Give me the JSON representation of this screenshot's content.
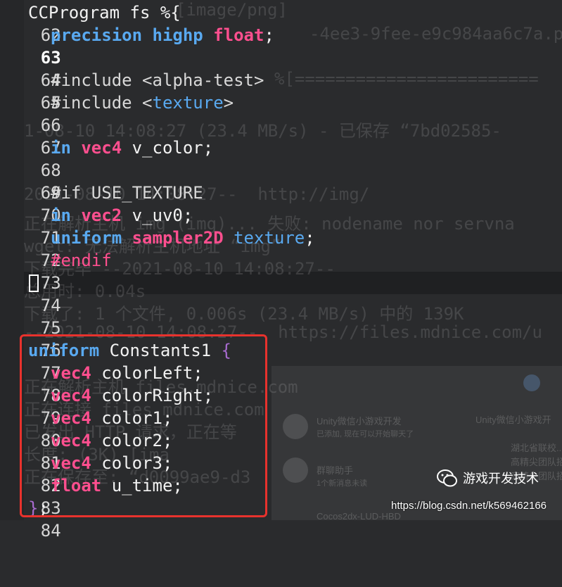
{
  "editor": {
    "active_line": "63",
    "lines": [
      {
        "n": "62",
        "tokens": [
          "CCProgram fs %{"
        ]
      },
      {
        "n": "63",
        "tokens": [
          "precision",
          "highp",
          "float",
          ";"
        ]
      },
      {
        "n": "64",
        "tokens": []
      },
      {
        "n": "65",
        "tokens": [
          "#include <alpha-test>"
        ]
      },
      {
        "n": "66",
        "tokens": [
          "#include <",
          "texture",
          ">"
        ]
      },
      {
        "n": "67",
        "tokens": []
      },
      {
        "n": "68",
        "tokens": [
          "in",
          "vec4",
          " v_color;"
        ]
      },
      {
        "n": "69",
        "tokens": []
      },
      {
        "n": "70",
        "tokens": [
          "#if USE_TEXTURE"
        ]
      },
      {
        "n": "71",
        "tokens": [
          "in",
          "vec2",
          " v_uv0;"
        ]
      },
      {
        "n": "72",
        "tokens": [
          "uniform",
          "sampler2D",
          "texture",
          ";"
        ]
      },
      {
        "n": "73",
        "tokens": [
          "#endif"
        ]
      },
      {
        "n": "74",
        "tokens": []
      },
      {
        "n": "75",
        "tokens": []
      },
      {
        "n": "76",
        "tokens": []
      },
      {
        "n": "77",
        "tokens": [
          "uniform",
          " Constants1 ",
          "{"
        ]
      },
      {
        "n": "78",
        "tokens": [
          "vec4",
          " colorLeft;"
        ]
      },
      {
        "n": "79",
        "tokens": [
          "vec4",
          " colorRight;"
        ]
      },
      {
        "n": "80",
        "tokens": [
          "vec4",
          " color1;"
        ]
      },
      {
        "n": "81",
        "tokens": [
          "vec4",
          " color2;"
        ]
      },
      {
        "n": "82",
        "tokens": [
          "vec4",
          " color3;"
        ]
      },
      {
        "n": "83",
        "tokens": [
          "float",
          " u_time;"
        ]
      },
      {
        "n": "84",
        "tokens": [
          "}",
          ";"
        ]
      }
    ]
  },
  "background_ghost": [
    "[image/png]",
    "-4ee3-9fee-e9c984aa6c7a.p",
    "%[========================",
    "1-08-10 14:08:27 (23.4 MB/s) - 已保存 “7bd02585-",
    "2021-08-10 14:08:27--  http://img/",
    "正在解析主机 img (img)... 失败: nodename nor servna",
    "wget: 无法解析主机地址 “img”",
    "下载完毕 --2021-08-10 14:08:27--",
    "总用时: 0.04s",
    "下载了: 1 个文件, 0.006s (23.4 MB/s) 中的 139K",
    "--2021-08-10 14:08:27--  https://files.mdnice.com/u",
    "正在解析主机 files.mdnice.com",
    "正在连接 files.mdnice.com",
    "已发出 HTTP 请求，正在等",
    "长度: (3K) [ima",
    "正在保存至: “d0099ae9-d3"
  ],
  "wechat_panel": {
    "items": [
      {
        "title": "Unity微信小游戏开发",
        "preview": "已添加, 现在可以开始聊天了"
      },
      {
        "title": "群聊助手",
        "preview": "1个新消息未读"
      },
      {
        "title": "Cocos2dx-LUD-HBD",
        "preview": ""
      }
    ],
    "side_title": "Unity微信小游戏开",
    "side_lines": [
      "湖北省联校...",
      "高精尖团队招",
      "高精尖团队招"
    ]
  },
  "watermark": {
    "icon": "wechat-icon",
    "name": "游戏开发技术",
    "url": "https://blog.csdn.net/k569462166"
  },
  "colors": {
    "background": "#2a2b2d",
    "keyword_blue": "#59a9f0",
    "keyword_pink": "#ff4f8f",
    "brace_purple": "#a86bd0",
    "highlight_red": "#e8322d"
  }
}
